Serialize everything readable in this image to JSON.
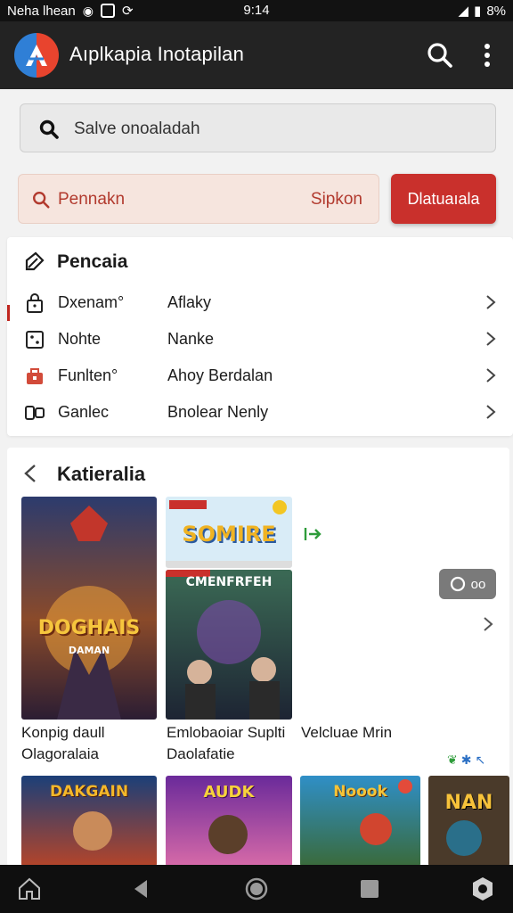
{
  "status_bar": {
    "carrier": "Neha lhean",
    "time": "9:14",
    "battery": "8%"
  },
  "app_bar": {
    "title": "Aıplkapia Inotapilan",
    "search_icon": "search-icon",
    "more_icon": "more-vert-icon"
  },
  "search": {
    "placeholder": "Salve onoaladah"
  },
  "filter": {
    "label": "Pennakn",
    "action": "Sipkon",
    "button": "Dlatuaıala"
  },
  "menu": {
    "title": "Pencaia",
    "rows": [
      {
        "key": "Dxenam°",
        "value": "Aflaky",
        "icon": "lock-icon"
      },
      {
        "key": "Nohte",
        "value": "Nanke",
        "icon": "dice-icon"
      },
      {
        "key": "Funlten°",
        "value": "Ahoy Berdalan",
        "icon": "toolbox-icon"
      },
      {
        "key": "Ganlec",
        "value": "Bnolear Nenly",
        "icon": "gamepad-icon"
      }
    ]
  },
  "gallery": {
    "title": "Katieralia",
    "posters": [
      {
        "text": "DOGHAIS",
        "sub": "DAMAN"
      },
      {
        "text": "SOMIRE"
      },
      {
        "text": "CMENFRFEH"
      },
      {
        "text": "DAKGAIN"
      },
      {
        "text": "AUDK"
      },
      {
        "text": "Noook"
      },
      {
        "text": "NAN"
      }
    ],
    "captions": [
      {
        "line1": "Konpig daull",
        "line2": "Olagoralaia"
      },
      {
        "line1": "Emlobaoiar Suplti",
        "line2": "Daolafatie"
      },
      {
        "line1": "Velcluae Mrin",
        "line2": ""
      }
    ],
    "chip": "oo",
    "accent_green": "#2e9c3a"
  },
  "colors": {
    "accent_red": "#c9302c",
    "appbar_bg": "#232323"
  }
}
